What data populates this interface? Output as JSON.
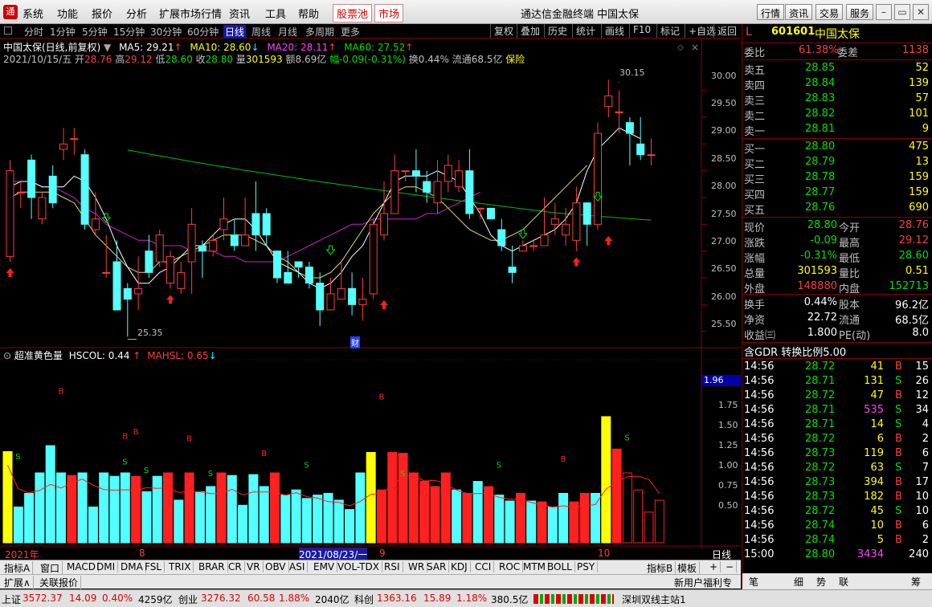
{
  "menu": {
    "items": [
      "系统",
      "功能",
      "报价",
      "分析",
      "扩展市场行情",
      "资讯",
      "工具",
      "帮助"
    ],
    "red_items": [
      "股票池",
      "市场"
    ],
    "title": "通达信金融终端  中国太保",
    "right_buttons": [
      "行情",
      "资讯",
      "交易",
      "服务"
    ]
  },
  "toolbar": {
    "periods": [
      "分时",
      "1分钟",
      "5分钟",
      "15分钟",
      "30分钟",
      "60分钟",
      "日线",
      "周线",
      "月线",
      "多周期",
      "更多"
    ],
    "active": "日线",
    "buttons": [
      "复权",
      "叠加",
      "历史",
      "统计",
      "画线",
      "F10",
      "标记",
      "+自选",
      "返回"
    ]
  },
  "chart_header": {
    "name": "中国太保(日线,前复权)",
    "ma5_label": "MA5: 29.21",
    "ma10_label": "MA10: 28.60",
    "ma20_label": "MA20: 28.11",
    "ma60_label": "MA60: 27.52",
    "date": "2021/10/15/五",
    "open_label": "开",
    "open": "28.76",
    "high_label": "高",
    "high": "29.12",
    "low_label": "低",
    "low": "28.60",
    "close_label": "收",
    "close": "28.80",
    "vol_label": "量",
    "vol": "301593",
    "amt": "额8.69亿",
    "chg": "幅-0.09(-0.31%)",
    "turnover": "换0.44%",
    "float": "流通68.5亿",
    "sector": "保险"
  },
  "chart_annotations": {
    "high_mark": "30.15",
    "low_mark": "25.35",
    "fin_mark": "财"
  },
  "ind_header": {
    "name": "超准黄色量",
    "hscol": "HSCOL: 0.44",
    "mahsl": "MAHSL: 0.65"
  },
  "price_axis": [
    "30.00",
    "29.50",
    "29.00",
    "28.50",
    "28.00",
    "27.50",
    "27.00",
    "26.50",
    "26.00",
    "25.50"
  ],
  "ind_axis": [
    "1.75",
    "1.50",
    "1.25",
    "1.00",
    "0.75",
    "0.50"
  ],
  "ind_value_box": "1.96",
  "x_labels": {
    "y2021": "2021年",
    "m8": "8",
    "date_box": "2021/08/23/一",
    "m9": "9",
    "m10": "10",
    "period": "日线"
  },
  "chart_data": {
    "type": "candlestick",
    "candles": [
      [
        26.9,
        28.5,
        26.8,
        28.7
      ],
      [
        28.1,
        28.1,
        27.8,
        28.3
      ],
      [
        28.7,
        28.0,
        27.6,
        28.8
      ],
      [
        27.6,
        28.0,
        27.5,
        28.1
      ],
      [
        28.4,
        27.9,
        27.8,
        28.6
      ],
      [
        28.9,
        29.0,
        28.7,
        29.3
      ],
      [
        29.1,
        29.1,
        28.8,
        29.3
      ],
      [
        28.8,
        27.5,
        27.4,
        28.9
      ],
      [
        27.4,
        27.6,
        27.3,
        28.1
      ],
      [
        26.6,
        26.6,
        26.5,
        27.3
      ],
      [
        26.8,
        25.9,
        25.9,
        27.2
      ],
      [
        26.3,
        26.1,
        25.4,
        26.4
      ],
      [
        26.2,
        26.3,
        25.9,
        26.9
      ],
      [
        27.0,
        26.6,
        26.5,
        27.3
      ],
      [
        26.8,
        27.3,
        26.7,
        27.4
      ],
      [
        26.4,
        26.9,
        26.3,
        27.0
      ],
      [
        26.3,
        26.6,
        26.2,
        26.8
      ],
      [
        26.8,
        27.5,
        26.2,
        27.8
      ],
      [
        27.1,
        27.0,
        26.5,
        27.2
      ],
      [
        27.0,
        27.2,
        26.9,
        27.3
      ],
      [
        27.4,
        27.6,
        27.2,
        28.0
      ],
      [
        27.3,
        27.1,
        27.0,
        27.6
      ],
      [
        27.1,
        27.3,
        27.1,
        28.0
      ],
      [
        27.7,
        27.3,
        27.0,
        28.3
      ],
      [
        27.7,
        27.3,
        27.1,
        27.8
      ],
      [
        27.0,
        26.5,
        26.4,
        27.0
      ],
      [
        26.6,
        26.4,
        26.4,
        27.0
      ],
      [
        26.8,
        26.7,
        26.5,
        26.8
      ],
      [
        26.7,
        26.4,
        26.3,
        26.8
      ],
      [
        26.4,
        25.9,
        25.6,
        26.6
      ],
      [
        25.9,
        26.2,
        25.9,
        26.5
      ],
      [
        26.1,
        26.3,
        26.1,
        26.8
      ],
      [
        26.3,
        26.0,
        25.8,
        26.6
      ],
      [
        26.0,
        26.1,
        25.7,
        26.5
      ],
      [
        26.2,
        27.5,
        26.1,
        27.6
      ],
      [
        27.3,
        27.7,
        27.2,
        28.3
      ],
      [
        27.7,
        28.5,
        27.7,
        28.8
      ],
      [
        28.5,
        28.5,
        28.3,
        28.5
      ],
      [
        28.5,
        28.4,
        28.1,
        28.9
      ],
      [
        28.3,
        28.1,
        27.9,
        28.5
      ],
      [
        27.9,
        28.3,
        27.7,
        28.7
      ],
      [
        28.3,
        28.6,
        28.1,
        28.8
      ],
      [
        28.2,
        28.5,
        28.1,
        28.7
      ],
      [
        28.5,
        27.7,
        27.6,
        28.9
      ],
      [
        27.8,
        27.8,
        27.6,
        27.8
      ],
      [
        27.8,
        27.6,
        27.6,
        27.8
      ],
      [
        27.4,
        27.1,
        27.0,
        27.6
      ],
      [
        26.7,
        26.6,
        26.4,
        27.1
      ],
      [
        27.0,
        27.1,
        27.0,
        27.2
      ],
      [
        27.1,
        27.1,
        27.0,
        27.2
      ],
      [
        27.1,
        27.3,
        27.1,
        28.0
      ],
      [
        27.5,
        27.6,
        27.3,
        27.9
      ],
      [
        27.3,
        27.5,
        27.1,
        27.8
      ],
      [
        27.2,
        27.9,
        27.0,
        28.2
      ],
      [
        27.9,
        27.5,
        27.1,
        27.9
      ],
      [
        27.5,
        29.2,
        27.4,
        29.4
      ],
      [
        29.7,
        29.9,
        29.5,
        30.2
      ],
      [
        29.6,
        29.6,
        29.2,
        30.0
      ],
      [
        29.4,
        29.2,
        28.6,
        29.5
      ],
      [
        29.0,
        28.8,
        28.7,
        29.5
      ],
      [
        28.8,
        28.8,
        28.6,
        29.1
      ]
    ],
    "volume": [
      1.07,
      0.42,
      0.58,
      0.82,
      1.14,
      0.82,
      0.79,
      0.82,
      0.42,
      0.82,
      0.78,
      0.82,
      0.78,
      0.6,
      0.78,
      0.82,
      0.5,
      0.82,
      0.6,
      0.66,
      0.82,
      0.79,
      0.44,
      0.8,
      0.66,
      0.82,
      0.56,
      0.62,
      0.52,
      0.56,
      0.58,
      0.5,
      0.39,
      0.82,
      1.06,
      0.62,
      1.06,
      1.05,
      0.82,
      0.72,
      0.66,
      0.82,
      0.62,
      0.58,
      0.72,
      0.66,
      0.56,
      0.49,
      0.58,
      0.49,
      0.48,
      0.42,
      0.58,
      0.48,
      0.58,
      0.58,
      1.48,
      1.1,
      0.82,
      0.62,
      0.36,
      0.5
    ],
    "ma5": [
      28.2,
      28.3,
      28.3,
      28.2,
      28.2,
      28.2,
      28.4,
      28.3,
      28.0,
      27.6,
      27.1,
      26.7,
      26.4,
      26.4,
      26.6,
      26.7,
      26.9,
      27.1,
      27.1,
      27.3,
      27.5,
      27.6,
      27.6,
      27.4,
      27.1,
      26.8,
      26.7,
      26.6,
      26.4,
      26.3,
      26.4,
      26.6,
      26.9,
      27.1,
      27.5,
      27.9,
      28.3,
      28.4,
      28.4,
      28.4,
      28.5,
      28.4,
      28.3,
      28.0,
      27.7,
      27.3,
      27.1,
      27.0,
      27.1,
      27.2,
      27.3,
      27.4,
      27.6,
      27.9,
      28.5,
      28.9,
      29.1,
      29.3,
      29.2,
      29.1
    ],
    "ma10": [
      28.0,
      28.1,
      28.1,
      28.1,
      28.1,
      28.0,
      27.9,
      27.6,
      27.3,
      27.1,
      26.9,
      26.7,
      26.6,
      26.6,
      26.8,
      26.8,
      26.9,
      27.0,
      27.1,
      27.2,
      27.3,
      27.3,
      27.3,
      27.2,
      27.1,
      26.9,
      26.8,
      26.6,
      26.5,
      26.5,
      26.6,
      26.8,
      27.1,
      27.4,
      27.7,
      27.9,
      28.1,
      28.2,
      28.2,
      28.1,
      28.0,
      27.8,
      27.6,
      27.4,
      27.3,
      27.2,
      27.2,
      27.3,
      27.4,
      27.6,
      27.8,
      28.0,
      28.2,
      28.4,
      28.6
    ],
    "ma20": [
      28.3,
      28.3,
      28.3,
      28.2,
      28.2,
      28.1,
      28.0,
      27.8,
      27.7,
      27.5,
      27.4,
      27.3,
      27.2,
      27.2,
      27.1,
      27.1,
      27.1,
      27.0,
      27.0,
      27.0,
      26.9,
      26.9,
      26.8,
      26.8,
      26.8,
      26.8,
      26.9,
      27.0,
      27.1,
      27.2,
      27.3,
      27.4,
      27.5,
      27.5,
      27.6,
      27.6,
      27.6,
      27.6,
      27.6,
      27.7,
      27.7,
      27.8,
      27.9,
      28.0,
      28.1
    ]
  },
  "quote": {
    "code": "601601",
    "name": "中国太保",
    "weibi_label": "委比",
    "weibi": "61.38%",
    "weicha_label": "委差",
    "weicha": "1138",
    "asks": [
      {
        "l": "卖五",
        "p": "28.85",
        "v": "52"
      },
      {
        "l": "卖四",
        "p": "28.84",
        "v": "139"
      },
      {
        "l": "卖三",
        "p": "28.83",
        "v": "57"
      },
      {
        "l": "卖二",
        "p": "28.82",
        "v": "101"
      },
      {
        "l": "卖一",
        "p": "28.81",
        "v": "9"
      }
    ],
    "bids": [
      {
        "l": "买一",
        "p": "28.80",
        "v": "475"
      },
      {
        "l": "买二",
        "p": "28.79",
        "v": "13"
      },
      {
        "l": "买三",
        "p": "28.78",
        "v": "159"
      },
      {
        "l": "买四",
        "p": "28.77",
        "v": "159"
      },
      {
        "l": "买五",
        "p": "28.76",
        "v": "690"
      }
    ],
    "stats": [
      [
        "现价",
        "28.80",
        "今开",
        "28.76"
      ],
      [
        "涨跌",
        "-0.09",
        "最高",
        "29.12"
      ],
      [
        "涨幅",
        "-0.31%",
        "最低",
        "28.60"
      ],
      [
        "总量",
        "301593",
        "量比",
        "0.51"
      ],
      [
        "外盘",
        "148880",
        "内盘",
        "152713"
      ]
    ],
    "stats2": [
      [
        "换手",
        "0.44%",
        "股本",
        "96.2亿"
      ],
      [
        "净资",
        "22.72",
        "流通",
        "68.5亿"
      ],
      [
        "收益㈢",
        "1.800",
        "PE(动)",
        "8.0"
      ]
    ],
    "gdr": "含GDR 转换比例5.00",
    "ticks": [
      [
        "14:56",
        "28.72",
        "41",
        "B",
        "15"
      ],
      [
        "14:56",
        "28.71",
        "131",
        "S",
        "26"
      ],
      [
        "14:56",
        "28.72",
        "47",
        "B",
        "12"
      ],
      [
        "14:56",
        "28.71",
        "535",
        "S",
        "34"
      ],
      [
        "14:56",
        "28.71",
        "14",
        "S",
        "4"
      ],
      [
        "14:56",
        "28.72",
        "6",
        "B",
        "2"
      ],
      [
        "14:56",
        "28.73",
        "119",
        "B",
        "6"
      ],
      [
        "14:56",
        "28.72",
        "63",
        "S",
        "7"
      ],
      [
        "14:56",
        "28.73",
        "394",
        "B",
        "17"
      ],
      [
        "14:56",
        "28.73",
        "182",
        "B",
        "10"
      ],
      [
        "14:56",
        "28.72",
        "45",
        "S",
        "10"
      ],
      [
        "14:56",
        "28.74",
        "10",
        "B",
        "6"
      ],
      [
        "14:56",
        "28.74",
        "5",
        "B",
        "2"
      ],
      [
        "15:00",
        "28.80",
        "3434",
        "",
        "240"
      ]
    ]
  },
  "bottom_tabs": [
    "指标A",
    "窗口",
    "MACD",
    "DMI",
    "DMA",
    "FSL",
    "TRIX",
    "BRAR",
    "CR",
    "VR",
    "OBV",
    "ASI",
    "EMV",
    "VOL-TDX",
    "RSI",
    "WR",
    "SAR",
    "KDJ",
    "CCI",
    "ROC",
    "MTM",
    "BOLL",
    "PSY"
  ],
  "bottom_tab_right": [
    "指标B",
    "模板"
  ],
  "bottom2": [
    "扩展∧",
    "关联报价"
  ],
  "bottom2_right": "新用户福利专享",
  "side_bottom": [
    "笔",
    "细",
    "势",
    "联",
    "筹"
  ],
  "status": {
    "sh_label": "上证",
    "sh": "3572.37",
    "sh_chg": "14.09",
    "sh_pct": "0.40%",
    "sh_amt": "4259亿",
    "cy_label": "创业",
    "cy": "3276.32",
    "cy_chg": "60.58",
    "cy_pct": "1.88%",
    "cy_amt": "2040亿",
    "kc_label": "科创",
    "kc": "1363.16",
    "kc_chg": "15.89",
    "kc_pct": "1.18%",
    "kc_amt": "380.5亿",
    "site": "深圳双线主站1"
  }
}
